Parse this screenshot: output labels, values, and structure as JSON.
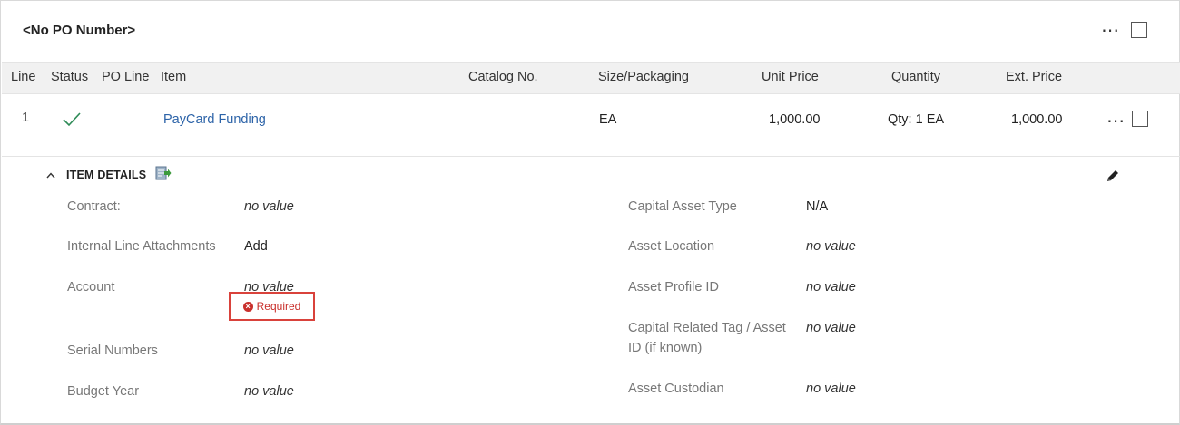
{
  "po": {
    "title": "<No PO Number>",
    "more_icon": "⋯"
  },
  "table": {
    "headers": {
      "line": "Line",
      "status": "Status",
      "po_line": "PO Line",
      "item": "Item",
      "catalog_no": "Catalog No.",
      "size_packaging": "Size/Packaging",
      "unit_price": "Unit Price",
      "quantity": "Quantity",
      "ext_price": "Ext. Price"
    },
    "row": {
      "line": "1",
      "item": "PayCard Funding",
      "size_packaging": "EA",
      "unit_price": "1,000.00",
      "quantity": "Qty: 1 EA",
      "ext_price": "1,000.00",
      "more_icon": "⋯",
      "status_icon": "checkmark-icon",
      "status_color": "#2e8b57"
    }
  },
  "item_details": {
    "title": "ITEM DETAILS",
    "caret": "^",
    "left_fields": [
      {
        "label": "Contract:",
        "value": "no value"
      },
      {
        "label": "Internal Line Attachments",
        "value": "Add"
      },
      {
        "label": "Account",
        "value": "no value"
      },
      {
        "label": "Serial Numbers",
        "value": "no value"
      },
      {
        "label": "Budget Year",
        "value": "no value"
      }
    ],
    "required_text": "Required",
    "required_color": "#c9302c",
    "right_fields": [
      {
        "label": "Capital Asset Type",
        "value": "N/A"
      },
      {
        "label": "Asset Location",
        "value": "no value"
      },
      {
        "label": "Asset Profile ID",
        "value": "no value"
      },
      {
        "label": "Capital Related Tag / Asset",
        "label2": "ID (if known)",
        "value": "no value"
      },
      {
        "label": "Asset Custodian",
        "value": "no value"
      }
    ]
  },
  "colors": {
    "link": "#2c63a8",
    "header_bg": "#f1f1f1"
  }
}
